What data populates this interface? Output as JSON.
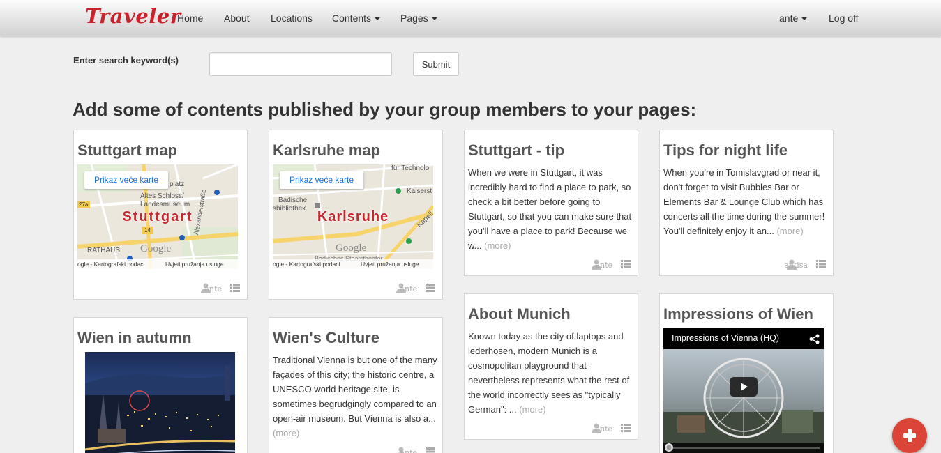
{
  "navbar": {
    "brand": "Traveler",
    "items": [
      {
        "label": "Home"
      },
      {
        "label": "About"
      },
      {
        "label": "Locations"
      },
      {
        "label": "Contents"
      },
      {
        "label": "Pages"
      }
    ],
    "user": "ante",
    "logoff": "Log off"
  },
  "search": {
    "label": "Enter search keyword(s)",
    "value": "",
    "placeholder": "",
    "submit": "Submit"
  },
  "heading": "Add some of contents published by your group members to your pages:",
  "cards": [
    {
      "title": "Stuttgart map",
      "map": {
        "button": "Prikaz veće karte",
        "city": "Stuttgart",
        "labels": [
          "platz",
          "Altes Schloss/",
          "Landesmuseum",
          "27a",
          "14",
          "Alexanderstraße",
          "RATHAUS",
          "Google"
        ],
        "footer_left": "ogle - Kartografski podaci",
        "footer_right": "Uvjeti pružanja usluge"
      },
      "user": "ante"
    },
    {
      "title": "Karlsruhe map",
      "map": {
        "button": "Prikaz veće karte",
        "city": "Karlsruhe",
        "labels": [
          "für Technolo",
          "Kaiserst",
          "Badische",
          "sbibliothek",
          "Kapell",
          "Google",
          "Badisches Staatstheater"
        ],
        "footer_left": "ogle - Kartografski podaci",
        "footer_right": "Uvjeti pružanja usluge"
      },
      "user": "ante"
    },
    {
      "title": "Stuttgart - tip",
      "text": "When we were in Stuttgart, it was incredibly hard to find a place to park, so check a bit better before going to Stuttgart, so that you can make sure that you'll have a place to park! Because we w... ",
      "more": "more",
      "user": "ante"
    },
    {
      "title": "Tips for night life",
      "text": "When you're in Tomislavgrad or near it, don't forget to visit Bubbles Bar or Elements Bar & Lounge Club which has concerts all the time during the summer! You'll definitely enjoy it an... ",
      "more": "more",
      "user": "antisa"
    },
    {
      "title": "About Munich",
      "text": "Known today as the city of laptops and lederhosen, modern Munich is a cosmopolitan playground that nevertheless represents what the rest of the world incorrectly sees as \"typically German\": ... ",
      "more": "more",
      "user": "ante"
    },
    {
      "title": "Impressions of Wien",
      "video_title": "Impressions of Vienna (HQ)"
    },
    {
      "title": "Wien in autumn"
    },
    {
      "title": "Wien's Culture",
      "text": "Traditional Vienna is but one of the many façades of this city; the historic centre, a UNESCO world heritage site, is sometimes begrudgingly compared to an open-air museum. But Vienna is also a... ",
      "more": "more",
      "user": "ante"
    }
  ],
  "icons": {
    "user": "user-icon",
    "list": "list-icon",
    "share": "share-icon",
    "play": "play-icon",
    "add": "plus-icon"
  },
  "colors": {
    "brand": "#c8232c",
    "fab": "#db4538",
    "more_link": "#aaaaaa"
  }
}
